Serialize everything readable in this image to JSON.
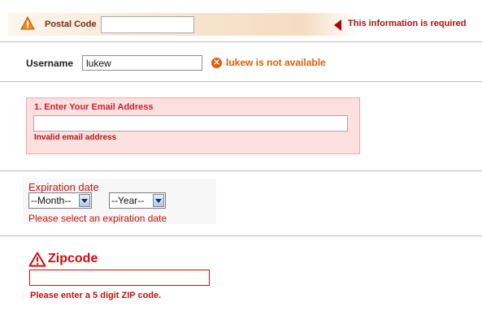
{
  "postal": {
    "label": "Postal Code",
    "value": "",
    "error": "This information is required",
    "icon": "warning-triangle-icon"
  },
  "username": {
    "label": "Username",
    "value": "lukew",
    "error": "lukew is not available",
    "icon": "error-x-icon"
  },
  "email": {
    "label": "1. Enter Your Email Address",
    "value": "",
    "error": "Invalid email address"
  },
  "expiration": {
    "label": "Expiration date",
    "month_selected": "--Month--",
    "year_selected": "--Year--",
    "error": "Please select an expiration date"
  },
  "zipcode": {
    "label": "Zipcode",
    "value": "",
    "error": "Please enter a 5 digit ZIP code.",
    "icon": "warning-triangle-icon"
  },
  "colors": {
    "error_red": "#c51010",
    "orange": "#d8600b",
    "pink_bg": "#ffe0e0"
  }
}
